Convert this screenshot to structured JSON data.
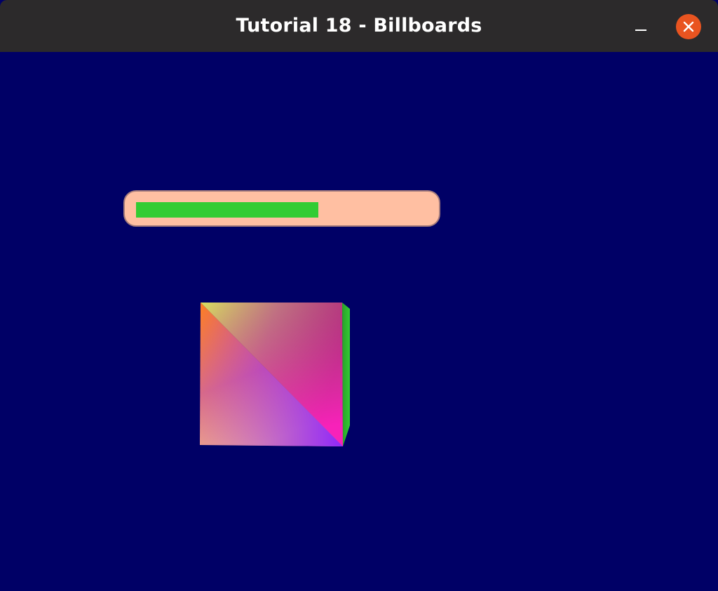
{
  "window": {
    "title": "Tutorial 18 - Billboards",
    "background_color": "#000066",
    "titlebar_color": "#2c2a2b"
  },
  "controls": {
    "minimize_icon": "minimize-icon",
    "close_icon": "close-icon",
    "close_color": "#e95420"
  },
  "billboard": {
    "background_color": "#ffbfa2",
    "border_color": "#a57c7c",
    "fill_color": "#33cc33",
    "progress_fraction": 0.59
  },
  "cube": {
    "colors": {
      "top_left": "#ff8020",
      "top_right": "#b04080",
      "bottom_left": "#f0b090",
      "bottom_right": "#a020ff",
      "diagonal_upper": "#d8e060",
      "diagonal_lower": "#ff20c0",
      "side": "#33cc33"
    }
  }
}
